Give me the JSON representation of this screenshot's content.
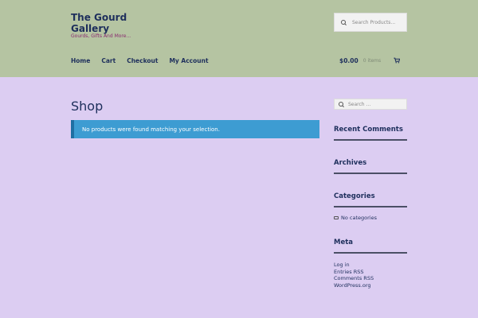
{
  "site": {
    "title": "The Gourd Gallery",
    "tagline": "Gourds, Gifts And More..."
  },
  "header_search": {
    "placeholder": "Search Products..."
  },
  "nav": {
    "items": [
      "Home",
      "Cart",
      "Checkout",
      "My Account"
    ]
  },
  "cart": {
    "amount": "$0.00",
    "count": "0 items"
  },
  "main": {
    "title": "Shop",
    "notice": "No products were found matching your selection."
  },
  "sidebar": {
    "search_placeholder": "Search ...",
    "recent_comments_title": "Recent Comments",
    "archives_title": "Archives",
    "categories_title": "Categories",
    "categories_empty": "No categories",
    "meta_title": "Meta",
    "meta_links": [
      "Log in",
      "Entries RSS",
      "Comments RSS",
      "WordPress.org"
    ]
  },
  "colors": {
    "header_bg": "#b5c4a2",
    "page_bg": "#dccdf2",
    "notice_bg": "#3d9cd2",
    "text": "#1e2f5c",
    "tagline": "#8a2b6f"
  }
}
